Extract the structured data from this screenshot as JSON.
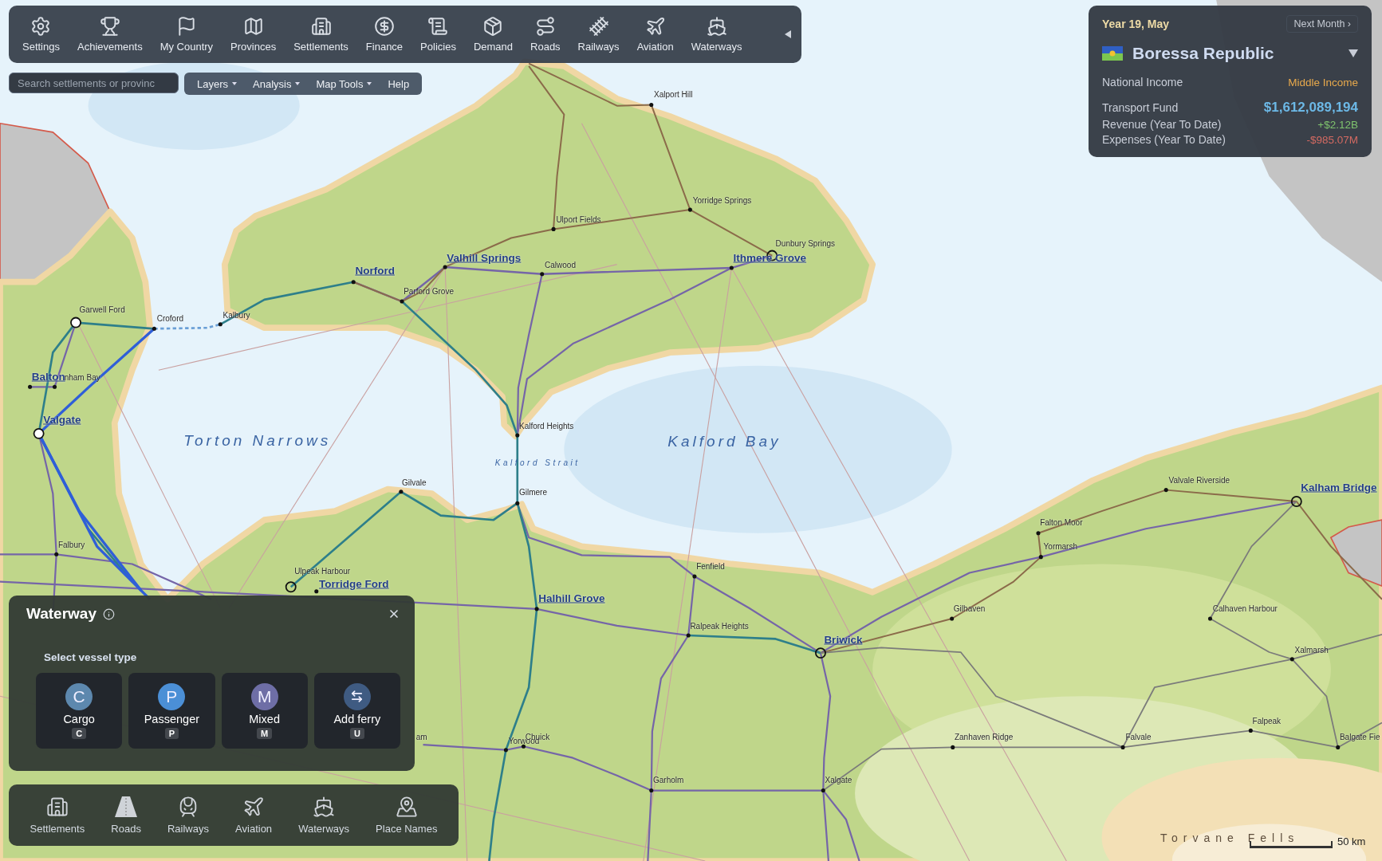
{
  "toolbar": {
    "items": [
      {
        "label": "Settings"
      },
      {
        "label": "Achievements"
      },
      {
        "label": "My Country"
      },
      {
        "label": "Provinces"
      },
      {
        "label": "Settlements"
      },
      {
        "label": "Finance"
      },
      {
        "label": "Policies"
      },
      {
        "label": "Demand"
      },
      {
        "label": "Roads"
      },
      {
        "label": "Railways"
      },
      {
        "label": "Aviation"
      },
      {
        "label": "Waterways"
      }
    ]
  },
  "search": {
    "placeholder": "Search settlements or provinc"
  },
  "menus": [
    {
      "label": "Layers",
      "dropdown": true
    },
    {
      "label": "Analysis",
      "dropdown": true
    },
    {
      "label": "Map Tools",
      "dropdown": true
    },
    {
      "label": "Help",
      "dropdown": false
    }
  ],
  "status_panel": {
    "date": "Year 19, May",
    "next_button": "Next Month ›",
    "country": "Boressa Republic",
    "rows": [
      {
        "label": "National Income",
        "value": "Middle Income",
        "color": "#e8a94c",
        "emphasis": false
      },
      {
        "label": "Transport Fund",
        "value": "$1,612,089,194",
        "color": "#6cb8e6",
        "emphasis": true
      },
      {
        "label": "Revenue (Year To Date)",
        "value": "+$2.12B",
        "color": "#7fc46e",
        "emphasis": false
      },
      {
        "label": "Expenses (Year To Date)",
        "value": "-$985.07M",
        "color": "#d46a62",
        "emphasis": false
      }
    ]
  },
  "map": {
    "places": [
      {
        "name": "Xalport Hill",
        "kind": "town"
      },
      {
        "name": "Yorridge Springs",
        "kind": "town"
      },
      {
        "name": "Ulport Fields",
        "kind": "town"
      },
      {
        "name": "Dunbury Springs",
        "kind": "town"
      },
      {
        "name": "Valhill Springs",
        "kind": "city"
      },
      {
        "name": "Ithmere Grove",
        "kind": "city"
      },
      {
        "name": "Calwood",
        "kind": "town"
      },
      {
        "name": "Norford",
        "kind": "city"
      },
      {
        "name": "Parford Grove",
        "kind": "town"
      },
      {
        "name": "Garwell Ford",
        "kind": "town"
      },
      {
        "name": "Croford",
        "kind": "town"
      },
      {
        "name": "Kalbury",
        "kind": "town"
      },
      {
        "name": "Balton",
        "kind": "city"
      },
      {
        "name": "nham Bay",
        "kind": "town"
      },
      {
        "name": "Valgate",
        "kind": "city"
      },
      {
        "name": "Kalford Heights",
        "kind": "town"
      },
      {
        "name": "Gilvale",
        "kind": "town"
      },
      {
        "name": "Gilmere",
        "kind": "town"
      },
      {
        "name": "Falbury",
        "kind": "town"
      },
      {
        "name": "Ulpeak Harbour",
        "kind": "town"
      },
      {
        "name": "Torridge Ford",
        "kind": "city"
      },
      {
        "name": "Fenfield",
        "kind": "town"
      },
      {
        "name": "Halhill Grove",
        "kind": "city"
      },
      {
        "name": "Ralpeak Heights",
        "kind": "town"
      },
      {
        "name": "Briwick",
        "kind": "city"
      },
      {
        "name": "Gilhaven",
        "kind": "town"
      },
      {
        "name": "Valvale Riverside",
        "kind": "town"
      },
      {
        "name": "Falton Moor",
        "kind": "town"
      },
      {
        "name": "Yormarsh",
        "kind": "town"
      },
      {
        "name": "Kalham Bridge",
        "kind": "city"
      },
      {
        "name": "Calhaven Harbour",
        "kind": "town"
      },
      {
        "name": "Xalmarsh",
        "kind": "town"
      },
      {
        "name": "Falpeak",
        "kind": "town"
      },
      {
        "name": "am",
        "kind": "town"
      },
      {
        "name": "Yorwood",
        "kind": "town"
      },
      {
        "name": "Chuick",
        "kind": "town"
      },
      {
        "name": "Zanhaven Ridge",
        "kind": "town"
      },
      {
        "name": "Falvale",
        "kind": "town"
      },
      {
        "name": "Balgate Fie",
        "kind": "town"
      },
      {
        "name": "Garholm",
        "kind": "town"
      },
      {
        "name": "Xalgate",
        "kind": "town"
      }
    ],
    "water_labels": [
      {
        "name": "Torton Narrows",
        "kind": "sea"
      },
      {
        "name": "Kalford Bay",
        "kind": "sea"
      },
      {
        "name": "Kalford Strait",
        "kind": "strait"
      }
    ],
    "region_label": "Torvane Fells",
    "scale": "50 km"
  },
  "waterway_panel": {
    "title": "Waterway",
    "prompt": "Select vessel type",
    "options": [
      {
        "label": "Cargo",
        "letter": "C",
        "key": "C",
        "color": "#5d88ae",
        "kind": "letter"
      },
      {
        "label": "Passenger",
        "letter": "P",
        "key": "P",
        "color": "#4b8fd6",
        "kind": "letter"
      },
      {
        "label": "Mixed",
        "letter": "M",
        "key": "M",
        "color": "#6e6ea6",
        "kind": "letter"
      },
      {
        "label": "Add ferry",
        "key": "U",
        "color": "#3f5b82",
        "kind": "icon"
      }
    ]
  },
  "bottom_bar": {
    "items": [
      {
        "label": "Settlements"
      },
      {
        "label": "Roads"
      },
      {
        "label": "Railways"
      },
      {
        "label": "Aviation"
      },
      {
        "label": "Waterways"
      },
      {
        "label": "Place Names"
      }
    ]
  }
}
